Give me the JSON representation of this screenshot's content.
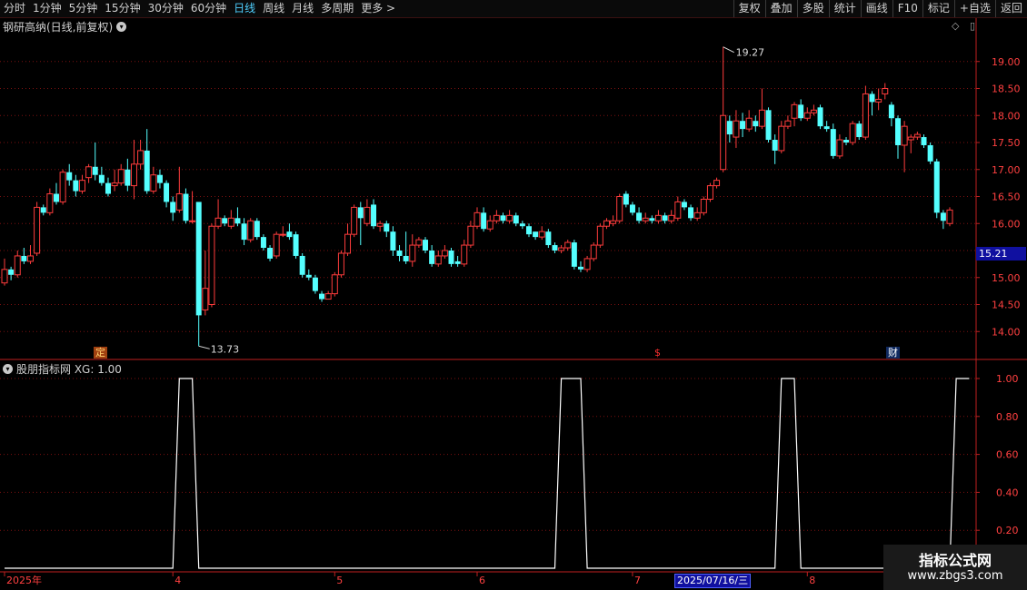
{
  "toolbar": {
    "periods": [
      "分时",
      "1分钟",
      "5分钟",
      "15分钟",
      "30分钟",
      "60分钟",
      "日线",
      "周线",
      "月线",
      "多周期",
      "更多 >"
    ],
    "active_index": 6,
    "actions": [
      "复权",
      "叠加",
      "多股",
      "统计",
      "画线",
      "F10",
      "标记",
      "+自选",
      "返回"
    ]
  },
  "chart_title": "钢研高纳(日线,前复权)",
  "indicator_title": "股朋指标网 XG: 1.00",
  "tags": {
    "ding": "定",
    "dollar": "$",
    "cai": "财"
  },
  "current_price_tag": "15.21",
  "selected_date": "2025/07/16/三",
  "watermark": {
    "line1": "指标公式网",
    "line2": "www.zbgs3.com"
  },
  "colors": {
    "up": "#ff3c3c",
    "down": "#54ffff",
    "grid": "#7a1010",
    "axis": "#c02020",
    "line": "#ffffff"
  },
  "chart_data": [
    {
      "type": "candlestick",
      "title": "钢研高纳(日线,前复权)",
      "ylim": [
        13.5,
        19.5
      ],
      "ticks": [
        "19.00",
        "18.50",
        "18.00",
        "17.50",
        "17.00",
        "16.50",
        "16.00",
        "15.50",
        "15.00",
        "14.50",
        "14.00"
      ],
      "high_label": "19.27",
      "low_label": "13.73",
      "candles": [
        [
          14.9,
          15.15,
          15.35,
          14.85
        ],
        [
          15.15,
          15.05,
          15.2,
          14.95
        ],
        [
          15.05,
          15.4,
          15.5,
          15.0
        ],
        [
          15.4,
          15.3,
          15.55,
          15.25
        ],
        [
          15.3,
          15.4,
          15.6,
          15.25
        ],
        [
          15.45,
          16.3,
          16.4,
          15.4
        ],
        [
          16.3,
          16.2,
          16.35,
          16.15
        ],
        [
          16.2,
          16.55,
          16.65,
          16.15
        ],
        [
          16.55,
          16.4,
          16.75,
          16.35
        ],
        [
          16.4,
          16.95,
          17.0,
          16.35
        ],
        [
          16.95,
          16.8,
          17.1,
          16.7
        ],
        [
          16.8,
          16.6,
          16.9,
          16.5
        ],
        [
          16.6,
          16.8,
          16.9,
          16.55
        ],
        [
          16.85,
          17.05,
          17.1,
          16.75
        ],
        [
          17.05,
          16.9,
          17.5,
          16.8
        ],
        [
          16.9,
          16.75,
          17.05,
          16.7
        ],
        [
          16.75,
          16.55,
          16.85,
          16.5
        ],
        [
          16.7,
          16.75,
          17.0,
          16.6
        ],
        [
          16.75,
          17.0,
          17.1,
          16.7
        ],
        [
          17.0,
          16.7,
          17.2,
          16.6
        ],
        [
          16.7,
          17.1,
          17.55,
          16.45
        ],
        [
          17.1,
          17.35,
          17.55,
          17.0
        ],
        [
          17.35,
          16.6,
          17.75,
          16.55
        ],
        [
          16.6,
          16.9,
          17.05,
          16.55
        ],
        [
          16.9,
          16.75,
          17.0,
          16.65
        ],
        [
          16.75,
          16.4,
          16.8,
          16.3
        ],
        [
          16.4,
          16.2,
          16.5,
          16.05
        ],
        [
          16.25,
          16.55,
          17.05,
          16.2
        ],
        [
          16.55,
          16.05,
          16.65,
          16.0
        ],
        [
          16.05,
          16.05,
          16.6,
          16.0
        ],
        [
          16.4,
          14.3,
          16.15,
          13.73
        ],
        [
          14.4,
          14.8,
          15.5,
          14.3
        ],
        [
          14.5,
          15.95,
          16.0,
          14.45
        ],
        [
          15.95,
          16.1,
          16.45,
          15.9
        ],
        [
          16.1,
          16.0,
          16.15,
          15.95
        ],
        [
          15.95,
          16.1,
          16.25,
          15.9
        ],
        [
          16.1,
          16.0,
          16.3,
          15.95
        ],
        [
          16.0,
          15.7,
          16.1,
          15.6
        ],
        [
          15.7,
          16.05,
          16.1,
          15.65
        ],
        [
          16.05,
          15.75,
          16.1,
          15.7
        ],
        [
          15.75,
          15.55,
          15.8,
          15.5
        ],
        [
          15.55,
          15.35,
          15.6,
          15.3
        ],
        [
          15.4,
          15.8,
          15.85,
          15.35
        ],
        [
          15.8,
          15.8,
          15.95,
          15.75
        ],
        [
          15.85,
          15.75,
          16.0,
          15.7
        ],
        [
          15.8,
          15.4,
          15.85,
          15.35
        ],
        [
          15.4,
          15.05,
          15.45,
          15.0
        ],
        [
          15.05,
          15.0,
          15.15,
          14.95
        ],
        [
          15.0,
          14.75,
          15.05,
          14.7
        ],
        [
          14.7,
          14.6,
          14.75,
          14.55
        ],
        [
          14.6,
          14.7,
          14.75,
          14.6
        ],
        [
          14.7,
          15.05,
          15.1,
          14.65
        ],
        [
          15.05,
          15.45,
          15.5,
          15.0
        ],
        [
          15.45,
          15.8,
          16.0,
          15.4
        ],
        [
          15.8,
          16.3,
          16.35,
          15.75
        ],
        [
          16.3,
          16.1,
          16.4,
          15.6
        ],
        [
          16.0,
          16.3,
          16.45,
          15.95
        ],
        [
          16.35,
          15.95,
          16.45,
          15.9
        ],
        [
          15.95,
          16.0,
          16.05,
          15.85
        ],
        [
          16.0,
          15.85,
          16.05,
          15.75
        ],
        [
          15.85,
          15.5,
          15.95,
          15.4
        ],
        [
          15.5,
          15.4,
          15.6,
          15.3
        ],
        [
          15.4,
          15.3,
          15.85,
          15.25
        ],
        [
          15.3,
          15.6,
          15.8,
          15.2
        ],
        [
          15.6,
          15.7,
          15.75,
          15.55
        ],
        [
          15.7,
          15.5,
          15.75,
          15.45
        ],
        [
          15.5,
          15.25,
          15.6,
          15.2
        ],
        [
          15.25,
          15.4,
          15.5,
          15.2
        ],
        [
          15.4,
          15.5,
          15.6,
          15.35
        ],
        [
          15.5,
          15.25,
          15.55,
          15.2
        ],
        [
          15.3,
          15.25,
          15.4,
          15.2
        ],
        [
          15.25,
          15.6,
          15.7,
          15.2
        ],
        [
          15.6,
          15.95,
          16.05,
          15.55
        ],
        [
          15.95,
          16.2,
          16.3,
          15.9
        ],
        [
          16.2,
          15.9,
          16.3,
          15.85
        ],
        [
          15.9,
          16.05,
          16.15,
          15.85
        ],
        [
          16.05,
          16.15,
          16.25,
          16.0
        ],
        [
          16.15,
          16.05,
          16.2,
          16.0
        ],
        [
          16.05,
          16.15,
          16.25,
          16.0
        ],
        [
          16.15,
          16.0,
          16.2,
          15.95
        ],
        [
          16.0,
          15.95,
          16.05,
          15.9
        ],
        [
          15.95,
          15.8,
          16.0,
          15.75
        ],
        [
          15.85,
          15.75,
          15.85,
          15.7
        ],
        [
          15.75,
          15.85,
          15.95,
          15.7
        ],
        [
          15.85,
          15.6,
          15.9,
          15.55
        ],
        [
          15.6,
          15.5,
          15.65,
          15.45
        ],
        [
          15.5,
          15.55,
          15.6,
          15.45
        ],
        [
          15.55,
          15.65,
          15.7,
          15.5
        ],
        [
          15.65,
          15.2,
          15.7,
          15.15
        ],
        [
          15.2,
          15.15,
          15.3,
          15.1
        ],
        [
          15.15,
          15.35,
          15.4,
          15.1
        ],
        [
          15.35,
          15.6,
          15.65,
          15.3
        ],
        [
          15.6,
          15.95,
          16.0,
          15.55
        ],
        [
          15.95,
          16.05,
          16.1,
          15.9
        ],
        [
          16.0,
          16.05,
          16.15,
          15.95
        ],
        [
          16.05,
          16.5,
          16.55,
          16.0
        ],
        [
          16.55,
          16.35,
          16.6,
          16.3
        ],
        [
          16.35,
          16.2,
          16.4,
          16.15
        ],
        [
          16.2,
          16.05,
          16.3,
          16.0
        ],
        [
          16.05,
          16.1,
          16.2,
          16.0
        ],
        [
          16.1,
          16.05,
          16.15,
          16.0
        ],
        [
          16.05,
          16.15,
          16.25,
          16.0
        ],
        [
          16.15,
          16.05,
          16.2,
          16.0
        ],
        [
          16.05,
          16.15,
          16.25,
          16.0
        ],
        [
          16.1,
          16.4,
          16.5,
          16.05
        ],
        [
          16.4,
          16.3,
          16.45,
          16.25
        ],
        [
          16.3,
          16.1,
          16.35,
          16.05
        ],
        [
          16.1,
          16.2,
          16.3,
          16.05
        ],
        [
          16.2,
          16.45,
          16.5,
          16.15
        ],
        [
          16.45,
          16.7,
          16.75,
          16.4
        ],
        [
          16.7,
          16.8,
          16.85,
          16.65
        ],
        [
          17.0,
          18.0,
          19.27,
          16.95
        ],
        [
          17.9,
          17.65,
          18.0,
          17.5
        ],
        [
          17.6,
          17.9,
          18.1,
          17.4
        ],
        [
          17.9,
          17.75,
          18.05,
          17.6
        ],
        [
          17.75,
          17.95,
          18.1,
          17.7
        ],
        [
          17.9,
          17.8,
          18.0,
          17.7
        ],
        [
          17.8,
          18.1,
          18.5,
          17.75
        ],
        [
          18.1,
          17.55,
          18.15,
          17.5
        ],
        [
          17.55,
          17.35,
          17.65,
          17.1
        ],
        [
          17.35,
          17.8,
          17.9,
          17.3
        ],
        [
          17.8,
          17.9,
          18.0,
          17.75
        ],
        [
          17.95,
          18.2,
          18.25,
          17.8
        ],
        [
          18.2,
          17.95,
          18.3,
          17.9
        ],
        [
          17.95,
          18.05,
          18.15,
          17.9
        ],
        [
          18.05,
          18.1,
          18.2,
          18.0
        ],
        [
          18.15,
          17.8,
          18.2,
          17.75
        ],
        [
          17.8,
          17.75,
          17.9,
          17.7
        ],
        [
          17.75,
          17.25,
          17.85,
          17.2
        ],
        [
          17.25,
          17.55,
          17.65,
          17.2
        ],
        [
          17.55,
          17.5,
          17.6,
          17.45
        ],
        [
          17.5,
          17.85,
          17.9,
          17.45
        ],
        [
          17.85,
          17.6,
          17.9,
          17.55
        ],
        [
          17.6,
          18.4,
          18.55,
          17.55
        ],
        [
          18.4,
          18.25,
          18.45,
          18.0
        ],
        [
          18.25,
          18.3,
          18.5,
          18.1
        ],
        [
          18.4,
          18.5,
          18.6,
          18.3
        ],
        [
          18.2,
          17.95,
          18.25,
          17.8
        ],
        [
          17.95,
          17.45,
          18.0,
          17.2
        ],
        [
          17.45,
          17.8,
          17.9,
          16.95
        ],
        [
          17.55,
          17.6,
          17.65,
          17.3
        ],
        [
          17.6,
          17.65,
          17.7,
          17.55
        ],
        [
          17.6,
          17.45,
          17.65,
          17.4
        ],
        [
          17.45,
          17.15,
          17.5,
          17.1
        ],
        [
          17.15,
          16.2,
          17.2,
          16.1
        ],
        [
          16.2,
          16.05,
          16.25,
          15.9
        ],
        [
          16.0,
          16.25,
          16.3,
          15.95
        ]
      ]
    },
    {
      "type": "line",
      "series": [
        {
          "name": "XG",
          "value_label": "1.00",
          "values": [
            0,
            0,
            0,
            0,
            0,
            0,
            0,
            0,
            0,
            0,
            0,
            0,
            0,
            0,
            0,
            0,
            0,
            0,
            0,
            0,
            0,
            0,
            0,
            0,
            0,
            0,
            0,
            1,
            1,
            1,
            0,
            0,
            0,
            0,
            0,
            0,
            0,
            0,
            0,
            0,
            0,
            0,
            0,
            0,
            0,
            0,
            0,
            0,
            0,
            0,
            0,
            0,
            0,
            0,
            0,
            0,
            0,
            0,
            0,
            0,
            0,
            0,
            0,
            0,
            0,
            0,
            0,
            0,
            0,
            0,
            0,
            0,
            0,
            0,
            0,
            0,
            0,
            0,
            0,
            0,
            0,
            0,
            0,
            0,
            0,
            0,
            1,
            1,
            1,
            1,
            0,
            0,
            0,
            0,
            0,
            0,
            0,
            0,
            0,
            0,
            0,
            0,
            0,
            0,
            0,
            0,
            0,
            0,
            0,
            0,
            0,
            0,
            0,
            0,
            0,
            0,
            0,
            0,
            0,
            0,
            1,
            1,
            1,
            0,
            0,
            0,
            0,
            0,
            0,
            0,
            0,
            0,
            0,
            0,
            0,
            0,
            0,
            0,
            0,
            0,
            0,
            0,
            0,
            0,
            0,
            0,
            0,
            1,
            1,
            1
          ]
        }
      ],
      "ylim": [
        0,
        1.0
      ],
      "ticks": [
        "1.00",
        "0.80",
        "0.60",
        "0.40",
        "0.20"
      ],
      "x_labels": [
        {
          "label": "2025年",
          "index": 0
        },
        {
          "label": "4",
          "index": 26
        },
        {
          "label": "5",
          "index": 51
        },
        {
          "label": "6",
          "index": 73
        },
        {
          "label": "7",
          "index": 97
        },
        {
          "label": "8",
          "index": 124
        }
      ]
    }
  ]
}
